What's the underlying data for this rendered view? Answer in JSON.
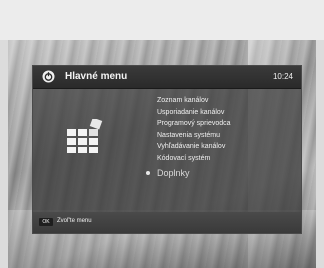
{
  "header": {
    "title": "Hlavné menu",
    "time": "10:24"
  },
  "menu": {
    "items": [
      {
        "label": "Zoznam kanálov"
      },
      {
        "label": "Usporiadanie kanálov"
      },
      {
        "label": "Programový sprievodca"
      },
      {
        "label": "Nastavenia systému"
      },
      {
        "label": "Vyhľadávanie kanálov"
      },
      {
        "label": "Kódovací systém"
      },
      {
        "label": "Doplnky",
        "selected": true
      }
    ]
  },
  "footer": {
    "key_label": "OK",
    "hint": "Zvoľ'te menu"
  },
  "icons": {
    "title_icon": "power-icon",
    "menu_icon": "grid-menu-icon"
  }
}
